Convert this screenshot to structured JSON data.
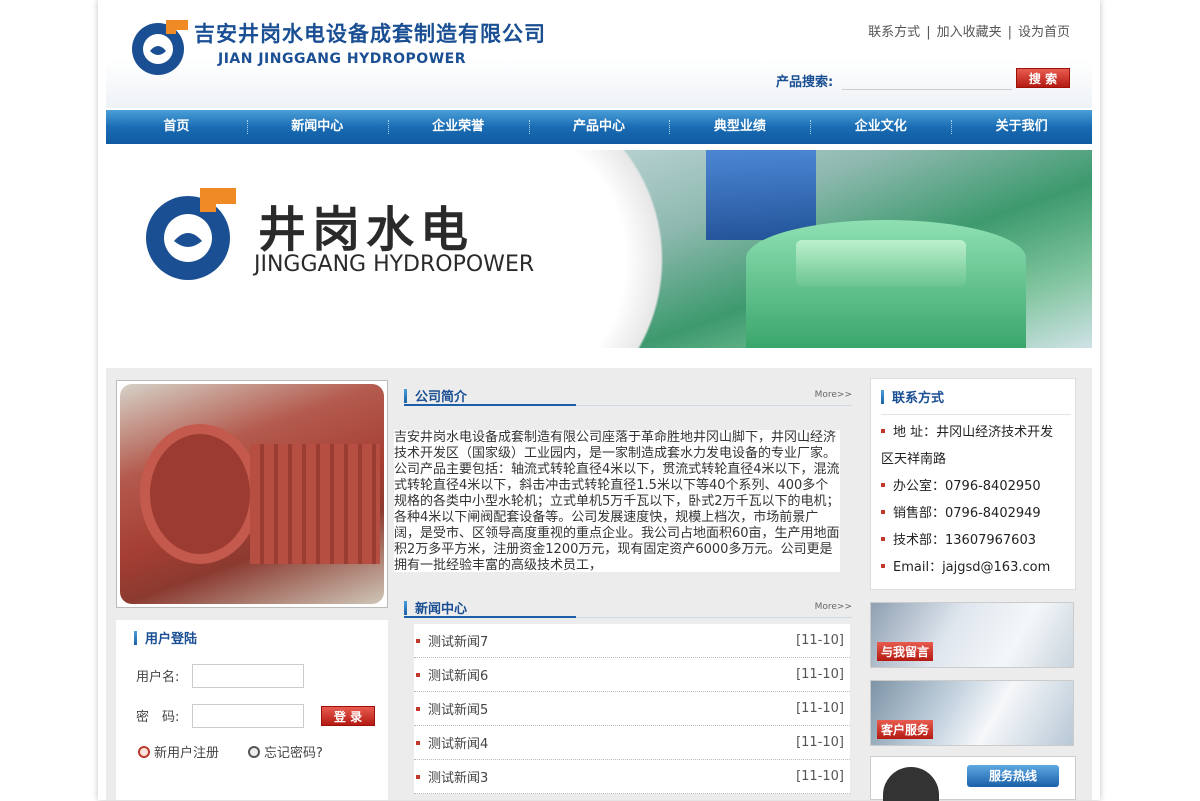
{
  "header": {
    "company_name_cn": "吉安井岗水电设备成套制造有限公司",
    "company_name_en": "JIAN JINGGANG HYDROPOWER",
    "top_links": [
      "联系方式",
      "加入收藏夹",
      "设为首页"
    ],
    "search_label": "产品搜索:",
    "search_placeholder": "",
    "search_button": "搜 索"
  },
  "nav": [
    "首页",
    "新闻中心",
    "企业荣誉",
    "产品中心",
    "典型业绩",
    "企业文化",
    "关于我们"
  ],
  "banner": {
    "title_cn": "井岗水电",
    "title_en": "JINGGANG HYDROPOWER"
  },
  "login": {
    "title": "用户登陆",
    "username_label": "用户名:",
    "password_label": "密　码:",
    "submit": "登 录",
    "register": "新用户注册",
    "forgot": "忘记密码?"
  },
  "intro": {
    "title": "公司简介",
    "more": "More>>",
    "text": "吉安井岗水电设备成套制造有限公司座落于革命胜地井冈山脚下，井冈山经济技术开发区（国家级）工业园内，是一家制造成套水力发电设备的专业厂家。公司产品主要包括：轴流式转轮直径4米以下，贯流式转轮直径4米以下，混流式转轮直径4米以下，斜击冲击式转轮直径1.5米以下等40个系列、400多个规格的各类中小型水轮机；立式单机5万千瓦以下，卧式2万千瓦以下的电机；各种4米以下闸阀配套设备等。公司发展速度快，规模上档次，市场前景广阔，是受市、区领导高度重视的重点企业。我公司占地面积60亩，生产用地面积2万多平方米，注册资金1200万元，现有固定资产6000多万元。公司更是拥有一批经验丰富的高级技术员工，"
  },
  "news": {
    "title": "新闻中心",
    "more": "More>>",
    "items": [
      {
        "title": "测试新闻7",
        "date": "[11-10]"
      },
      {
        "title": "测试新闻6",
        "date": "[11-10]"
      },
      {
        "title": "测试新闻5",
        "date": "[11-10]"
      },
      {
        "title": "测试新闻4",
        "date": "[11-10]"
      },
      {
        "title": "测试新闻3",
        "date": "[11-10]"
      }
    ]
  },
  "contact": {
    "title": "联系方式",
    "lines": [
      "地 址：井冈山经济技术开发",
      "区天祥南路",
      "办公室：0796-8402950",
      "销售部：0796-8402949",
      "技术部：13607967603",
      "Email：jajgsd@163.com"
    ]
  },
  "promos": {
    "message": "与我留言",
    "service": "客户服务",
    "hotline": "服务热线"
  },
  "colors": {
    "brand_blue": "#1a4f93",
    "nav_blue": "#1a6cb4",
    "accent_red": "#b41a12"
  }
}
